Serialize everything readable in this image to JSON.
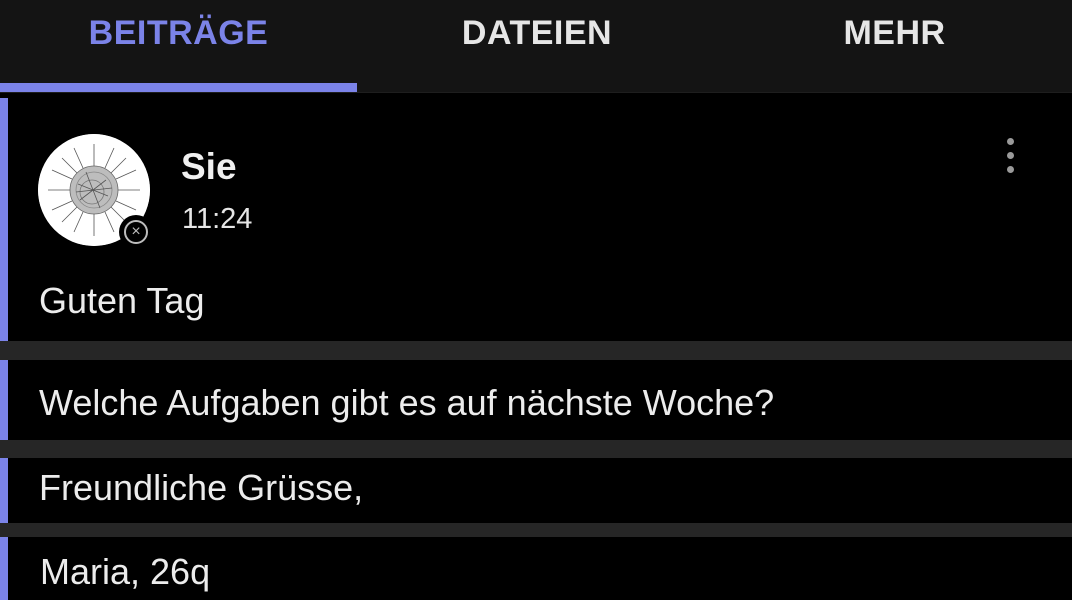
{
  "tabs": [
    {
      "label": "BEITRÄGE",
      "active": true
    },
    {
      "label": "DATEIEN",
      "active": false
    },
    {
      "label": "MEHR",
      "active": false
    }
  ],
  "colors": {
    "accent": "#7b83e8",
    "background": "#000000",
    "tabbar": "#141414",
    "separator": "#262626"
  },
  "post": {
    "author": "Sie",
    "time": "11:24",
    "status_icon": "offline-x-icon",
    "menu_icon": "more-vertical-icon"
  },
  "messages": [
    "Guten Tag",
    "Welche Aufgaben gibt es auf nächste Woche?",
    "Freundliche Grüsse,",
    "Maria, 26q"
  ]
}
